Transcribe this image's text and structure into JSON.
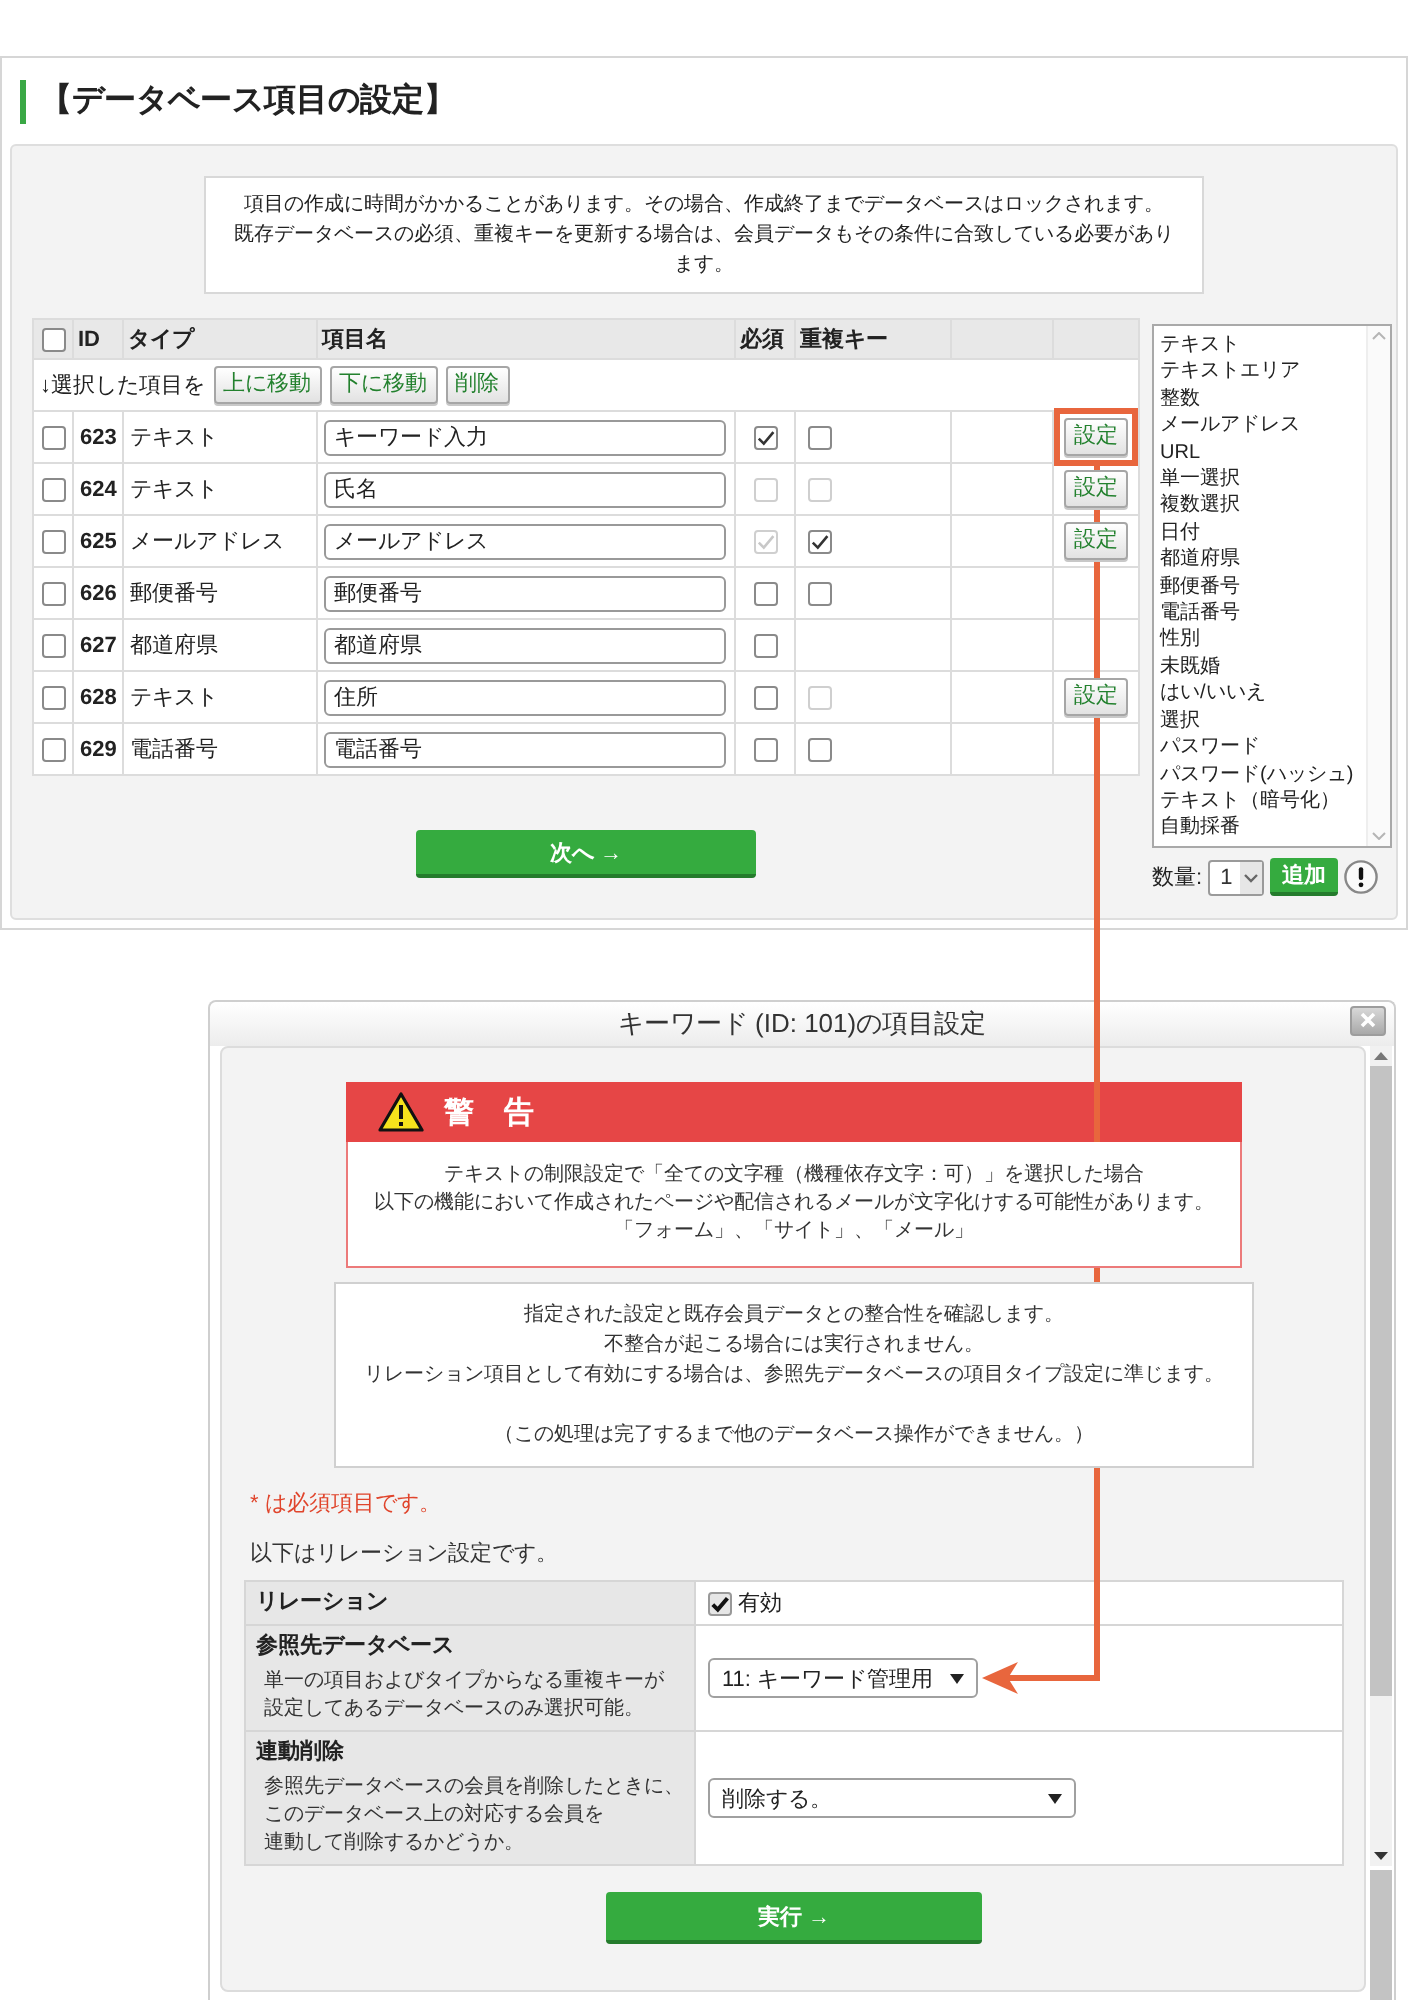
{
  "page": {
    "title": "【データベース項目の設定】",
    "notice": [
      "項目の作成に時間がかかることがあります。その場合、作成終了までデータベースはロックされます。",
      "既存データベースの必須、重複キーを更新する場合は、会員データもその条件に合致している必要があります。"
    ]
  },
  "table": {
    "select_all": {
      "checked": false
    },
    "columns": [
      "ID",
      "タイプ",
      "項目名",
      "必須",
      "重複キー"
    ],
    "bulk_label": "↓選択した項目を",
    "bulk_buttons": [
      "上に移動",
      "下に移動",
      "削除"
    ],
    "rows": [
      {
        "selected": false,
        "id": "623",
        "type": "テキスト",
        "name": "キーワード入力",
        "required": {
          "checked": true,
          "disabled": false
        },
        "duplicate_key": {
          "checked": false,
          "disabled": false
        },
        "setting_button": {
          "label": "設定",
          "highlighted": true
        }
      },
      {
        "selected": false,
        "id": "624",
        "type": "テキスト",
        "name": "氏名",
        "required": {
          "checked": false,
          "disabled": true
        },
        "duplicate_key": {
          "checked": false,
          "disabled": true
        },
        "setting_button": {
          "label": "設定",
          "highlighted": false
        }
      },
      {
        "selected": false,
        "id": "625",
        "type": "メールアドレス",
        "name": "メールアドレス",
        "required": {
          "checked": true,
          "disabled": true
        },
        "duplicate_key": {
          "checked": true,
          "disabled": false
        },
        "setting_button": {
          "label": "設定",
          "highlighted": false
        }
      },
      {
        "selected": false,
        "id": "626",
        "type": "郵便番号",
        "name": "郵便番号",
        "required": {
          "checked": false,
          "disabled": false
        },
        "duplicate_key": {
          "checked": false,
          "disabled": false
        }
      },
      {
        "selected": false,
        "id": "627",
        "type": "都道府県",
        "name": "都道府県",
        "required": {
          "checked": false,
          "disabled": false
        }
      },
      {
        "selected": false,
        "id": "628",
        "type": "テキスト",
        "name": "住所",
        "required": {
          "checked": false,
          "disabled": false
        },
        "duplicate_key": {
          "checked": false,
          "disabled": true
        },
        "setting_button": {
          "label": "設定",
          "highlighted": false
        }
      },
      {
        "selected": false,
        "id": "629",
        "type": "電話番号",
        "name": "電話番号",
        "required": {
          "checked": false,
          "disabled": false
        },
        "duplicate_key": {
          "checked": false,
          "disabled": false
        }
      }
    ],
    "next_button": "次へ →"
  },
  "type_list": {
    "items": [
      {
        "label": "テキスト",
        "selected": false
      },
      {
        "label": "テキストエリア",
        "selected": false
      },
      {
        "label": "整数",
        "selected": false
      },
      {
        "label": "メールアドレス",
        "selected": false
      },
      {
        "label": "URL",
        "selected": false
      },
      {
        "label": "単一選択",
        "selected": false
      },
      {
        "label": "複数選択",
        "selected": false
      },
      {
        "label": "日付",
        "selected": false
      },
      {
        "label": "都道府県",
        "selected": false
      },
      {
        "label": "郵便番号",
        "selected": false
      },
      {
        "label": "電話番号",
        "selected": false
      },
      {
        "label": "性別",
        "selected": false
      },
      {
        "label": "未既婚",
        "selected": false
      },
      {
        "label": "はい/いいえ",
        "selected": false
      },
      {
        "label": "選択",
        "selected": false
      },
      {
        "label": "パスワード",
        "selected": false
      },
      {
        "label": "パスワード(ハッシュ)",
        "selected": false
      },
      {
        "label": "テキスト（暗号化）",
        "selected": false
      },
      {
        "label": "自動採番",
        "selected": false
      }
    ],
    "quantity": {
      "label": "数量:",
      "value": "1"
    },
    "add_button": "追加"
  },
  "dialog": {
    "title": "キーワード (ID: 101)の項目設定",
    "warning": {
      "title": "警　告",
      "lines": [
        "テキストの制限設定で「全ての文字種（機種依存文字：可）」を選択した場合",
        "以下の機能において作成されたページや配信されるメールが文字化けする可能性があります。",
        "「フォーム」、「サイト」、「メール」"
      ]
    },
    "info": {
      "paragraphs": [
        [
          "指定された設定と既存会員データとの整合性を確認します。",
          "不整合が起こる場合には実行されません。",
          "リレーション項目として有効にする場合は、参照先データベースの項目タイプ設定に準じます。"
        ],
        [
          "（この処理は完了するまで他のデータベース操作ができません。）"
        ]
      ]
    },
    "required_note": "* は必須項目です。",
    "relation_intro": "以下はリレーション設定です。",
    "relation_table": {
      "rows": [
        {
          "kind": "checkbox",
          "label": "リレーション",
          "checked": true,
          "option": "有効"
        },
        {
          "kind": "select",
          "label": "参照先データベース",
          "description": [
            "単一の項目およびタイプからなる重複キーが",
            "設定してあるデータベースのみ選択可能。"
          ],
          "value": "11: キーワード管理用",
          "highlighted": true
        },
        {
          "kind": "select",
          "label": "連動削除",
          "description": [
            "参照先データベースの会員を削除したときに、",
            "このデータベース上の対応する会員を",
            "連動して削除するかどうか。"
          ],
          "value": "削除する。",
          "highlighted": false
        }
      ]
    },
    "execute_button": "実行 →"
  }
}
